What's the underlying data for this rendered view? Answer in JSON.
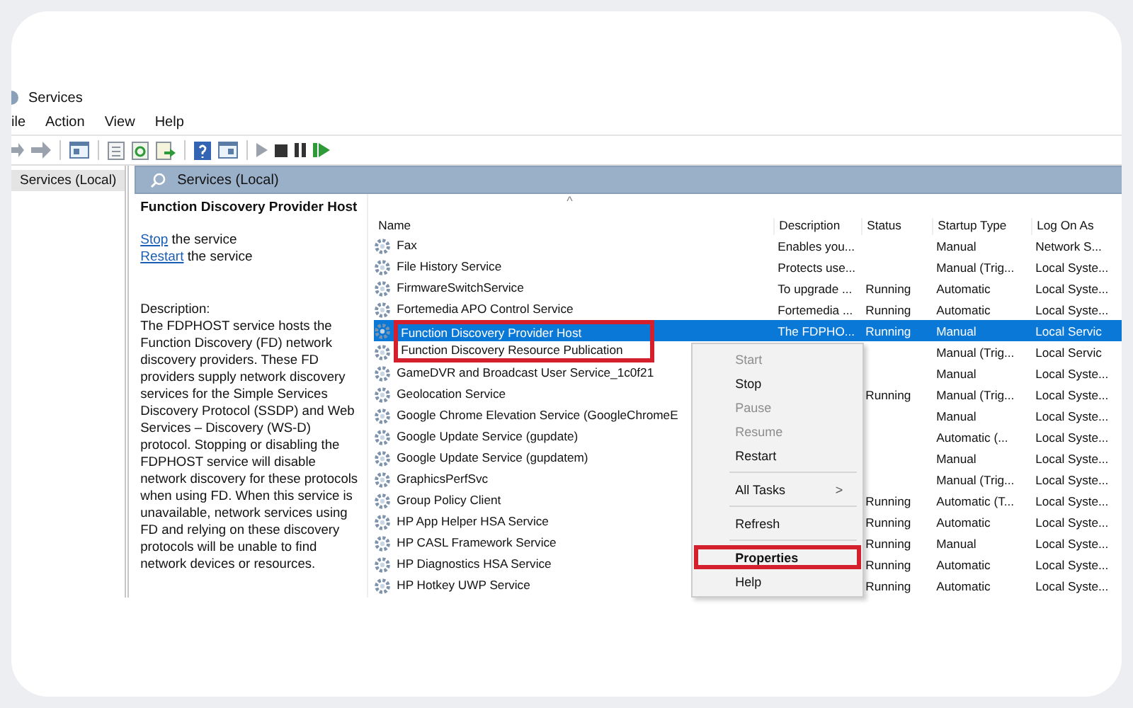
{
  "window": {
    "title": "Services"
  },
  "menu": [
    "ile",
    "Action",
    "View",
    "Help"
  ],
  "tree": {
    "items": [
      {
        "label": "Services (Local)",
        "selected": true
      }
    ]
  },
  "pane_header": "Services (Local)",
  "details": {
    "title": "Function Discovery Provider Host",
    "actions": [
      {
        "link": "Stop",
        "text": " the service"
      },
      {
        "link": "Restart",
        "text": " the service"
      }
    ],
    "description_label": "Description:",
    "description": "The FDPHOST service hosts the Function Discovery (FD) network discovery providers. These FD providers supply network discovery services for the Simple Services Discovery Protocol (SSDP) and Web Services – Discovery (WS-D) protocol. Stopping or disabling the FDPHOST service will disable network discovery for these protocols when using FD. When this service is unavailable, network services using FD and relying on these discovery protocols will be unable to find network devices or resources."
  },
  "table": {
    "sort_indicator": "^",
    "columns": [
      "Name",
      "Description",
      "Status",
      "Startup Type",
      "Log On As"
    ],
    "rows": [
      {
        "name": "Fax",
        "description": "Enables you...",
        "status": "",
        "startup": "Manual",
        "logon": "Network S...",
        "selected": false,
        "highlighted": false
      },
      {
        "name": "File History Service",
        "description": "Protects use...",
        "status": "",
        "startup": "Manual (Trig...",
        "logon": "Local Syste...",
        "selected": false,
        "highlighted": false
      },
      {
        "name": "FirmwareSwitchService",
        "description": "To upgrade ...",
        "status": "Running",
        "startup": "Automatic",
        "logon": "Local Syste...",
        "selected": false,
        "highlighted": false
      },
      {
        "name": "Fortemedia APO Control Service",
        "description": "Fortemedia ...",
        "status": "Running",
        "startup": "Automatic",
        "logon": "Local Syste...",
        "selected": false,
        "highlighted": false
      },
      {
        "name": "Function Discovery Provider Host",
        "description": "The FDPHO...",
        "status": "Running",
        "startup": "Manual",
        "logon": "Local Servic",
        "selected": true,
        "highlighted": true
      },
      {
        "name": "Function Discovery Resource Publication",
        "status": "",
        "startup": "Manual (Trig...",
        "logon": "Local Servic",
        "selected": false,
        "highlighted": true
      },
      {
        "name": "GameDVR and Broadcast User Service_1c0f21",
        "status": "",
        "startup": "Manual",
        "logon": "Local Syste...",
        "selected": false,
        "highlighted": false
      },
      {
        "name": "Geolocation Service",
        "status": "Running",
        "startup": "Manual (Trig...",
        "logon": "Local Syste...",
        "selected": false,
        "highlighted": false
      },
      {
        "name": "Google Chrome Elevation Service (GoogleChromeE",
        "status": "",
        "startup": "Manual",
        "logon": "Local Syste...",
        "selected": false,
        "highlighted": false
      },
      {
        "name": "Google Update Service (gupdate)",
        "status": "",
        "startup": "Automatic (...",
        "logon": "Local Syste...",
        "selected": false,
        "highlighted": false
      },
      {
        "name": "Google Update Service (gupdatem)",
        "status": "",
        "startup": "Manual",
        "logon": "Local Syste...",
        "selected": false,
        "highlighted": false
      },
      {
        "name": "GraphicsPerfSvc",
        "status": "",
        "startup": "Manual (Trig...",
        "logon": "Local Syste...",
        "selected": false,
        "highlighted": false
      },
      {
        "name": "Group Policy Client",
        "status": "Running",
        "startup": "Automatic (T...",
        "logon": "Local Syste...",
        "selected": false,
        "highlighted": false
      },
      {
        "name": "HP App Helper HSA Service",
        "status": "Running",
        "startup": "Automatic",
        "logon": "Local Syste...",
        "selected": false,
        "highlighted": false
      },
      {
        "name": "HP CASL Framework Service",
        "status": "Running",
        "startup": "Manual",
        "logon": "Local Syste...",
        "selected": false,
        "highlighted": false
      },
      {
        "name": "HP Diagnostics HSA Service",
        "status": "Running",
        "startup": "Automatic",
        "logon": "Local Syste...",
        "selected": false,
        "highlighted": false
      },
      {
        "name": "HP Hotkey UWP Service",
        "status": "Running",
        "startup": "Automatic",
        "logon": "Local Syste...",
        "selected": false,
        "highlighted": false
      }
    ]
  },
  "context_menu": {
    "items": [
      {
        "kind": "item",
        "label": "Start",
        "disabled": true
      },
      {
        "kind": "item",
        "label": "Stop",
        "disabled": false
      },
      {
        "kind": "item",
        "label": "Pause",
        "disabled": true
      },
      {
        "kind": "item",
        "label": "Resume",
        "disabled": true
      },
      {
        "kind": "item",
        "label": "Restart",
        "disabled": false
      },
      {
        "kind": "separator"
      },
      {
        "kind": "submenu",
        "label": "All Tasks",
        "arrow": ">",
        "disabled": false
      },
      {
        "kind": "separator"
      },
      {
        "kind": "item",
        "label": "Refresh",
        "disabled": false
      },
      {
        "kind": "separator"
      },
      {
        "kind": "item",
        "label": "Properties",
        "disabled": false,
        "default": true,
        "highlighted": true
      },
      {
        "kind": "item",
        "label": "Help",
        "disabled": false
      }
    ]
  }
}
